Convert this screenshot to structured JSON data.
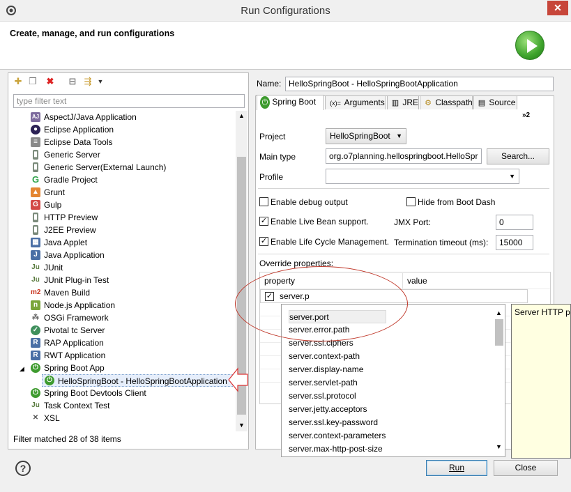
{
  "window": {
    "title": "Run Configurations",
    "close_glyph": "✕"
  },
  "header": {
    "title": "Create, manage, and run configurations"
  },
  "left": {
    "filter_placeholder": "type filter text",
    "tree": [
      {
        "label": "AspectJ/Java Application",
        "icon": "aspectj-icon",
        "color": "#7d6b9e",
        "glyph": "AJ"
      },
      {
        "label": "Eclipse Application",
        "icon": "eclipse-icon",
        "color": "#2c2255",
        "glyph": "●"
      },
      {
        "label": "Eclipse Data Tools",
        "icon": "database-icon",
        "color": "#8a8a8a",
        "glyph": "≡"
      },
      {
        "label": "Generic Server",
        "icon": "server-icon",
        "color": "#7a8a7a",
        "glyph": "▮"
      },
      {
        "label": "Generic Server(External Launch)",
        "icon": "server-icon",
        "color": "#7a8a7a",
        "glyph": "▮"
      },
      {
        "label": "Gradle Project",
        "icon": "gradle-icon",
        "color": "#2fa34a",
        "glyph": "G"
      },
      {
        "label": "Grunt",
        "icon": "grunt-icon",
        "color": "#e48632",
        "glyph": "▲"
      },
      {
        "label": "Gulp",
        "icon": "gulp-icon",
        "color": "#d34a47",
        "glyph": "G"
      },
      {
        "label": "HTTP Preview",
        "icon": "server-icon",
        "color": "#7a8a7a",
        "glyph": "▮"
      },
      {
        "label": "J2EE Preview",
        "icon": "server-icon",
        "color": "#7a8a7a",
        "glyph": "▮"
      },
      {
        "label": "Java Applet",
        "icon": "applet-icon",
        "color": "#4a6fa5",
        "glyph": "▦"
      },
      {
        "label": "Java Application",
        "icon": "java-icon",
        "color": "#4a6fa5",
        "glyph": "J"
      },
      {
        "label": "JUnit",
        "icon": "junit-icon",
        "color": "#5a7b3f",
        "glyph": "Ju"
      },
      {
        "label": "JUnit Plug-in Test",
        "icon": "junit-plugin-icon",
        "color": "#5a7b3f",
        "glyph": "Ju"
      },
      {
        "label": "Maven Build",
        "icon": "maven-icon",
        "color": "#c8341f",
        "glyph": "m2"
      },
      {
        "label": "Node.js Application",
        "icon": "nodejs-icon",
        "color": "#7aa63b",
        "glyph": "n"
      },
      {
        "label": "OSGi Framework",
        "icon": "osgi-icon",
        "color": "#666666",
        "glyph": "⁂"
      },
      {
        "label": "Pivotal tc Server",
        "icon": "pivotal-icon",
        "color": "#3f8f5c",
        "glyph": "✓"
      },
      {
        "label": "RAP Application",
        "icon": "rap-icon",
        "color": "#4a6fa5",
        "glyph": "R"
      },
      {
        "label": "RWT Application",
        "icon": "rwt-icon",
        "color": "#4a6fa5",
        "glyph": "R"
      },
      {
        "label": "Spring Boot App",
        "icon": "spring-boot-icon",
        "color": "#3e9b2f",
        "glyph": "⏻"
      },
      {
        "label": "HelloSpringBoot - HelloSpringBootApplication",
        "icon": "spring-boot-icon",
        "color": "#3e9b2f",
        "glyph": "⏻"
      },
      {
        "label": "Spring Boot Devtools Client",
        "icon": "spring-boot-icon",
        "color": "#3e9b2f",
        "glyph": "⏻"
      },
      {
        "label": "Task Context Test",
        "icon": "junit-icon",
        "color": "#5a7b3f",
        "glyph": "Ju"
      },
      {
        "label": "XSL",
        "icon": "xsl-icon",
        "color": "#555555",
        "glyph": "✕"
      }
    ],
    "status": "Filter matched 28 of 38 items"
  },
  "right": {
    "name_label": "Name:",
    "name_value": "HelloSpringBoot - HelloSpringBootApplication",
    "tabs": [
      {
        "label": "Spring Boot",
        "glyph": "⏻",
        "icon": "spring-boot-icon"
      },
      {
        "label": "Arguments",
        "glyph": "(x)=",
        "icon": "arguments-icon"
      },
      {
        "label": "JRE",
        "glyph": "▥",
        "icon": "jre-icon"
      },
      {
        "label": "Classpath",
        "glyph": "⚙",
        "icon": "classpath-icon"
      },
      {
        "label": "Source",
        "glyph": "▤",
        "icon": "source-icon"
      }
    ],
    "overflow_tabs": "»2",
    "project_label": "Project",
    "project_value": "HelloSpringBoot",
    "main_type_label": "Main type",
    "main_type_value": "org.o7planning.hellospringboot.HelloSpr",
    "search_button": "Search...",
    "profile_label": "Profile",
    "profile_value": "",
    "enable_debug": "Enable debug output",
    "hide_boot_dash": "Hide from Boot Dash",
    "enable_live_bean": "Enable Live Bean support.",
    "jmx_label": "JMX Port:",
    "jmx_value": "0",
    "enable_lifecycle": "Enable Life Cycle Management.",
    "termination_label": "Termination timeout (ms):",
    "termination_value": "15000",
    "override_label": "Override properties:",
    "col_property": "property",
    "col_value": "value",
    "row_property": "server.p",
    "suggestions": [
      "server.port",
      "server.error.path",
      "server.ssl.ciphers",
      "server.context-path",
      "server.display-name",
      "server.servlet-path",
      "server.ssl.protocol",
      "server.jetty.acceptors",
      "server.ssl.key-password",
      "server.context-parameters",
      "server.max-http-post-size"
    ],
    "tooltip": "Server HTTP po"
  },
  "footer": {
    "help": "?",
    "run_button": "Run",
    "close_button": "Close"
  }
}
